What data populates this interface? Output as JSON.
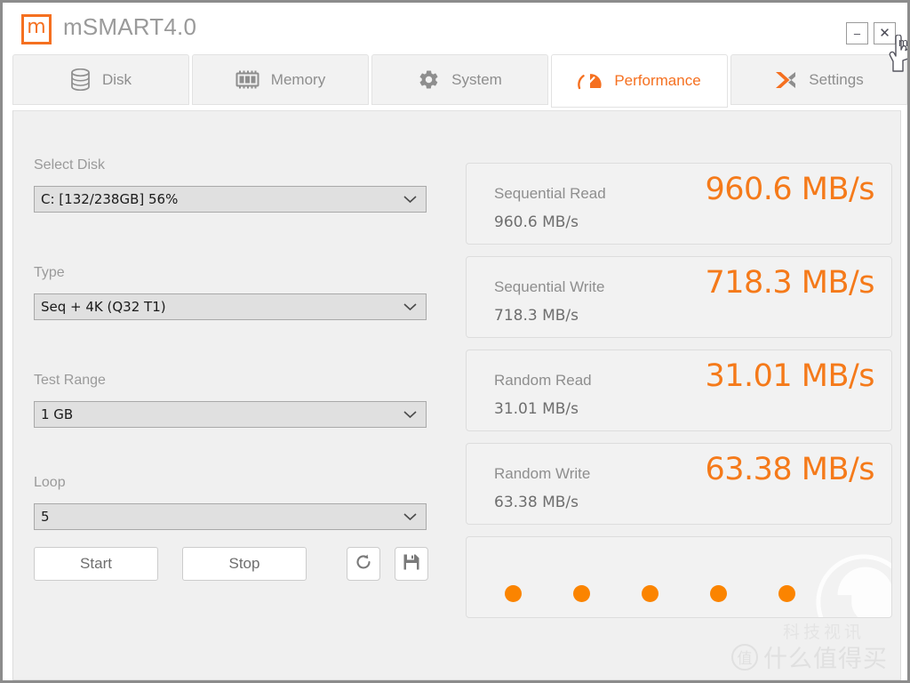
{
  "window": {
    "logo_letter": "m",
    "title": "mSMART4.0",
    "minimize_label": "–",
    "close_label": "✕",
    "cursor_label": "m"
  },
  "tabs": [
    {
      "id": "disk",
      "label": "Disk",
      "icon": "disk-icon",
      "active": false
    },
    {
      "id": "memory",
      "label": "Memory",
      "icon": "memory-chip-icon",
      "active": false
    },
    {
      "id": "system",
      "label": "System",
      "icon": "gear-icon",
      "active": false
    },
    {
      "id": "performance",
      "label": "Performance",
      "icon": "gauge-icon",
      "active": true
    },
    {
      "id": "settings",
      "label": "Settings",
      "icon": "cross-arrows-icon",
      "active": false
    }
  ],
  "form": {
    "select_disk": {
      "label": "Select Disk",
      "value": "C: [132/238GB] 56%"
    },
    "type": {
      "label": "Type",
      "value": "Seq + 4K (Q32 T1)"
    },
    "test_range": {
      "label": "Test Range",
      "value": "1 GB"
    },
    "loop": {
      "label": "Loop",
      "value": "5"
    },
    "buttons": {
      "start": "Start",
      "stop": "Stop",
      "refresh_icon": "refresh-icon",
      "save_icon": "save-floppy-icon"
    }
  },
  "results": [
    {
      "name": "Sequential Read",
      "value": "960.6 MB/s",
      "detail": "960.6 MB/s"
    },
    {
      "name": "Sequential Write",
      "value": "718.3 MB/s",
      "detail": "718.3 MB/s"
    },
    {
      "name": "Random Read",
      "value": "31.01 MB/s",
      "detail": "31.01 MB/s"
    },
    {
      "name": "Random Write",
      "value": "63.38 MB/s",
      "detail": "63.38 MB/s"
    }
  ],
  "progress": {
    "total_dots": 5,
    "completed_dots": 5
  },
  "watermark": {
    "line1": "科技视讯",
    "badge": "值",
    "line2": "什么值得买"
  },
  "colors": {
    "accent": "#F57020",
    "value_orange": "#F57A1A",
    "dot_orange": "#FB8400",
    "label_gray": "#9a9a9a",
    "panel_bg": "#f0f0f0",
    "card_bg": "#f2f2f2"
  }
}
